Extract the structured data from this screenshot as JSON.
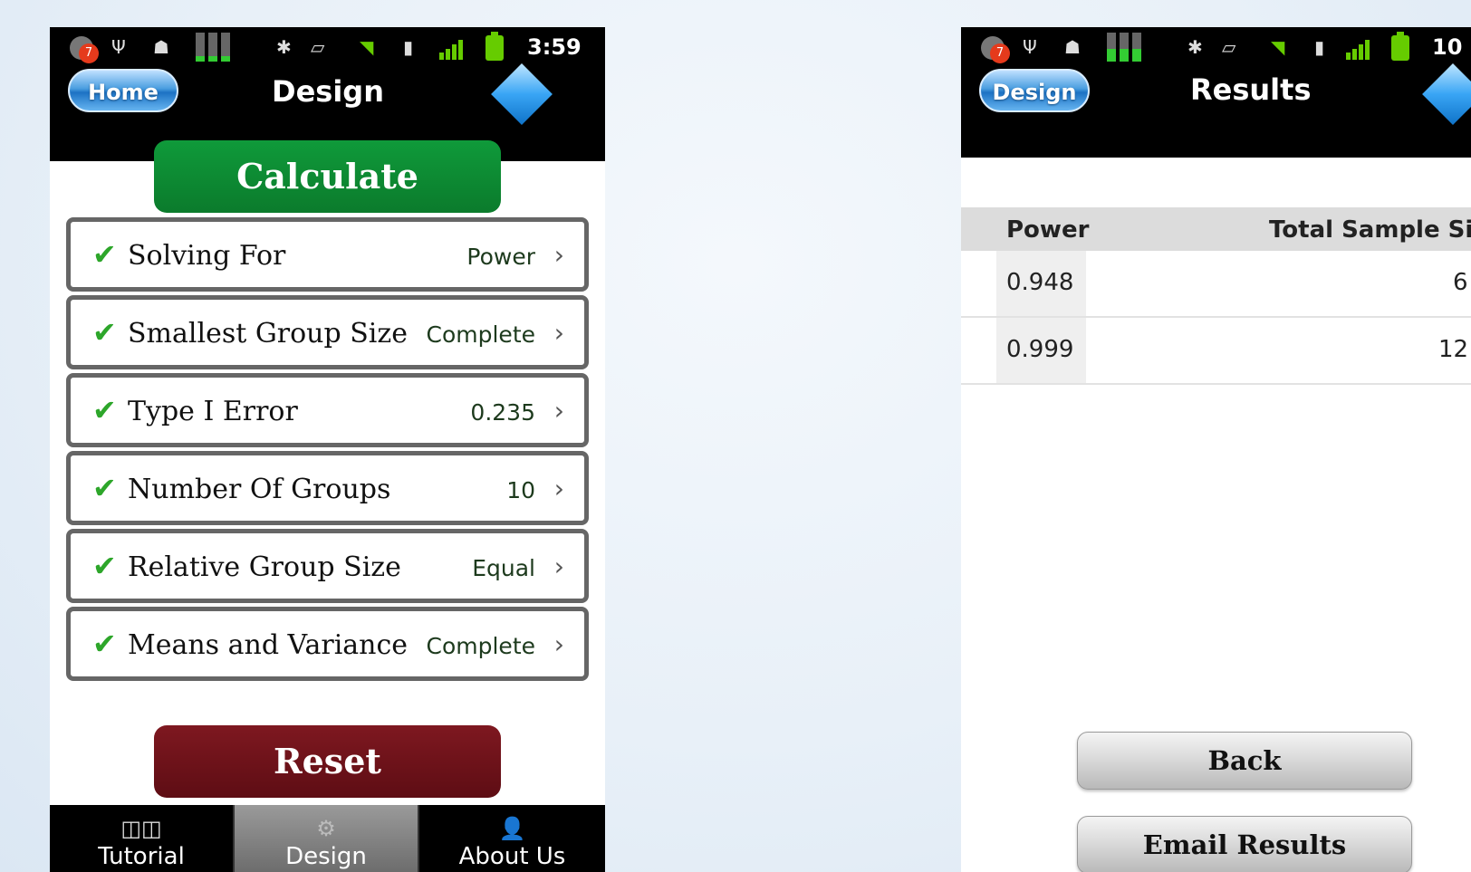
{
  "left_screen": {
    "status": {
      "notification_count": "7",
      "time": "3:59"
    },
    "header": {
      "nav_button": "Home",
      "title": "Design"
    },
    "calculate_label": "Calculate",
    "rows": [
      {
        "label": "Solving For",
        "value": "Power"
      },
      {
        "label": "Smallest Group Size",
        "value": "Complete"
      },
      {
        "label": "Type I Error",
        "value": "0.235"
      },
      {
        "label": "Number Of Groups",
        "value": "10"
      },
      {
        "label": "Relative Group Size",
        "value": "Equal"
      },
      {
        "label": "Means and Variance",
        "value": "Complete"
      }
    ],
    "reset_label": "Reset",
    "tabs": [
      {
        "label": "Tutorial",
        "icon": "glasses-icon"
      },
      {
        "label": "Design",
        "icon": "gears-icon",
        "active": true
      },
      {
        "label": "About Us",
        "icon": "person-icon"
      }
    ]
  },
  "right_screen": {
    "status": {
      "notification_count": "7",
      "time": "10"
    },
    "header": {
      "nav_button": "Design",
      "title": "Results"
    },
    "table": {
      "headers": [
        "Power",
        "Total Sample Si"
      ],
      "rows": [
        [
          "0.948",
          "6"
        ],
        [
          "0.999",
          "12"
        ]
      ]
    },
    "back_label": "Back",
    "email_label": "Email Results"
  },
  "colors": {
    "calculate_green": "#0b8a33",
    "reset_red": "#6e121a",
    "check_green": "#2da62a",
    "nav_blue": "#3a8fd6"
  }
}
